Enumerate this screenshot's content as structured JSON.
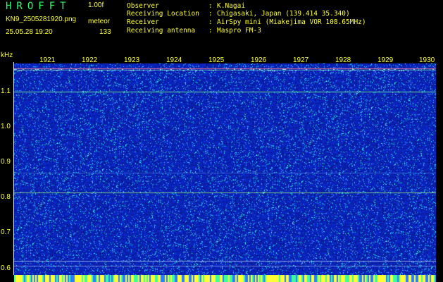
{
  "header": {
    "app_title": "HROFFT",
    "version": "1.00f",
    "filename": "KN9_2505281920.png",
    "mode": "meteor",
    "datetime": "25.05.28 19:20",
    "count": "133"
  },
  "info": {
    "rows": [
      {
        "label": "Observer",
        "value": "K.Nagai"
      },
      {
        "label": "Receiving Location",
        "value": "Chigasaki, Japan (139.414 35.340)"
      },
      {
        "label": "Receiver",
        "value": "AirSpy mini (Miakejima VOR 108.65MHz)"
      },
      {
        "label": "Receiving antenna",
        "value": "Maspro FM-3"
      }
    ],
    "separator": ":"
  },
  "axes": {
    "y_unit": "kHz",
    "x_ticks": [
      "1921",
      "1922",
      "1923",
      "1924",
      "1925",
      "1926",
      "1927",
      "1928",
      "1929",
      "1930"
    ],
    "y_ticks": [
      "1.1",
      "1.0",
      "0.9",
      "0.8",
      "0.7",
      "0.6"
    ]
  },
  "colors": {
    "background": "#0a1aa0",
    "noise": "#2a5fff",
    "trace": "#4dffd0",
    "text": "#ffff33",
    "title": "#2dff6a"
  }
}
